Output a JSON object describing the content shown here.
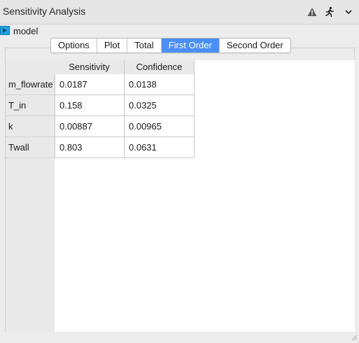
{
  "window": {
    "title": "Sensitivity Analysis"
  },
  "toolbar_icons": [
    "warning-icon",
    "run-icon",
    "chevron-down-icon"
  ],
  "model": {
    "label": "model"
  },
  "tabs": [
    {
      "label": "Options",
      "active": false
    },
    {
      "label": "Plot",
      "active": false
    },
    {
      "label": "Total",
      "active": false
    },
    {
      "label": "First Order",
      "active": true
    },
    {
      "label": "Second Order",
      "active": false
    }
  ],
  "colors": {
    "accent": "#4a8ff5",
    "model_icon": "#23a2e0"
  },
  "table": {
    "columns": [
      "Sensitivity",
      "Confidence"
    ],
    "rows": [
      {
        "name": "m_flowrate",
        "sensitivity": "0.0187",
        "confidence": "0.0138"
      },
      {
        "name": "T_in",
        "sensitivity": "0.158",
        "confidence": "0.0325"
      },
      {
        "name": "k",
        "sensitivity": "0.00887",
        "confidence": "0.00965"
      },
      {
        "name": "Twall",
        "sensitivity": "0.803",
        "confidence": "0.0631"
      }
    ]
  }
}
